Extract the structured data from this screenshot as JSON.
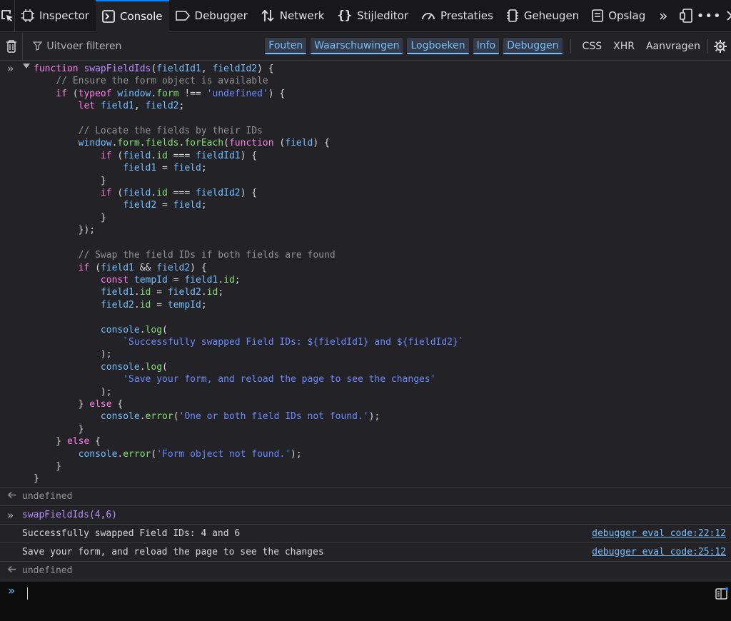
{
  "tabs": {
    "inspector": "Inspector",
    "console": "Console",
    "debugger": "Debugger",
    "network": "Netwerk",
    "style_editor": "Stijleditor",
    "performance": "Prestaties",
    "memory": "Geheugen",
    "storage": "Opslag"
  },
  "toolbar": {
    "filter_placeholder": "Uitvoer filteren",
    "levels": [
      "Fouten",
      "Waarschuwingen",
      "Logboeken",
      "Info",
      "Debuggen"
    ],
    "requests": [
      "CSS",
      "XHR",
      "Aanvragen"
    ]
  },
  "console": {
    "code_lines": [
      [
        [
          "kw",
          "function "
        ],
        [
          "fn",
          "swapFieldIds"
        ],
        [
          "",
          "("
        ],
        [
          "vr",
          "fieldId1"
        ],
        [
          "",
          ", "
        ],
        [
          "vr",
          "fieldId2"
        ],
        [
          "",
          ") {"
        ]
      ],
      [
        [
          "cm",
          "    // Ensure the form object is available"
        ]
      ],
      [
        [
          "kw",
          "    if "
        ],
        [
          "",
          "("
        ],
        [
          "kw",
          "typeof "
        ],
        [
          "vr",
          "window"
        ],
        [
          "",
          "."
        ],
        [
          "pr",
          "form"
        ],
        [
          "",
          " !== "
        ],
        [
          "st",
          "'undefined'"
        ],
        [
          "",
          ") {"
        ]
      ],
      [
        [
          "kw",
          "        let "
        ],
        [
          "vr",
          "field1"
        ],
        [
          "",
          ", "
        ],
        [
          "vr",
          "field2"
        ],
        [
          "",
          ";"
        ]
      ],
      [
        [
          "",
          ""
        ]
      ],
      [
        [
          "cm",
          "        // Locate the fields by their IDs"
        ]
      ],
      [
        [
          "vr",
          "        window"
        ],
        [
          "",
          "."
        ],
        [
          "pr",
          "form"
        ],
        [
          "",
          "."
        ],
        [
          "pr",
          "fields"
        ],
        [
          "",
          "."
        ],
        [
          "pr",
          "forEach"
        ],
        [
          "",
          "("
        ],
        [
          "kw",
          "function "
        ],
        [
          "",
          "("
        ],
        [
          "vr",
          "field"
        ],
        [
          "",
          ") {"
        ]
      ],
      [
        [
          "kw",
          "            if "
        ],
        [
          "",
          "("
        ],
        [
          "vr",
          "field"
        ],
        [
          "",
          "."
        ],
        [
          "pr",
          "id"
        ],
        [
          "",
          " === "
        ],
        [
          "vr",
          "fieldId1"
        ],
        [
          "",
          ") {"
        ]
      ],
      [
        [
          "vr",
          "                field1"
        ],
        [
          "",
          " = "
        ],
        [
          "vr",
          "field"
        ],
        [
          "",
          ";"
        ]
      ],
      [
        [
          "",
          "            }"
        ]
      ],
      [
        [
          "kw",
          "            if "
        ],
        [
          "",
          "("
        ],
        [
          "vr",
          "field"
        ],
        [
          "",
          "."
        ],
        [
          "pr",
          "id"
        ],
        [
          "",
          " === "
        ],
        [
          "vr",
          "fieldId2"
        ],
        [
          "",
          ") {"
        ]
      ],
      [
        [
          "vr",
          "                field2"
        ],
        [
          "",
          " = "
        ],
        [
          "vr",
          "field"
        ],
        [
          "",
          ";"
        ]
      ],
      [
        [
          "",
          "            }"
        ]
      ],
      [
        [
          "",
          "        });"
        ]
      ],
      [
        [
          "",
          ""
        ]
      ],
      [
        [
          "cm",
          "        // Swap the field IDs if both fields are found"
        ]
      ],
      [
        [
          "kw",
          "        if "
        ],
        [
          "",
          "("
        ],
        [
          "vr",
          "field1"
        ],
        [
          "",
          " && "
        ],
        [
          "vr",
          "field2"
        ],
        [
          "",
          ") {"
        ]
      ],
      [
        [
          "kw",
          "            const "
        ],
        [
          "vr",
          "tempId"
        ],
        [
          "",
          " = "
        ],
        [
          "vr",
          "field1"
        ],
        [
          "",
          "."
        ],
        [
          "pr",
          "id"
        ],
        [
          "",
          ";"
        ]
      ],
      [
        [
          "vr",
          "            field1"
        ],
        [
          "",
          "."
        ],
        [
          "pr",
          "id"
        ],
        [
          "",
          " = "
        ],
        [
          "vr",
          "field2"
        ],
        [
          "",
          "."
        ],
        [
          "pr",
          "id"
        ],
        [
          "",
          ";"
        ]
      ],
      [
        [
          "vr",
          "            field2"
        ],
        [
          "",
          "."
        ],
        [
          "pr",
          "id"
        ],
        [
          "",
          " = "
        ],
        [
          "vr",
          "tempId"
        ],
        [
          "",
          ";"
        ]
      ],
      [
        [
          "",
          ""
        ]
      ],
      [
        [
          "vr",
          "            console"
        ],
        [
          "",
          "."
        ],
        [
          "pr",
          "log"
        ],
        [
          "",
          "("
        ]
      ],
      [
        [
          "st",
          "                `Successfully swapped Field IDs: ${fieldId1} and ${fieldId2}`"
        ]
      ],
      [
        [
          "",
          "            );"
        ]
      ],
      [
        [
          "vr",
          "            console"
        ],
        [
          "",
          "."
        ],
        [
          "pr",
          "log"
        ],
        [
          "",
          "("
        ]
      ],
      [
        [
          "st",
          "                'Save your form, and reload the page to see the changes'"
        ]
      ],
      [
        [
          "",
          "            );"
        ]
      ],
      [
        [
          "",
          "        } "
        ],
        [
          "kw",
          "else"
        ],
        [
          "",
          " {"
        ]
      ],
      [
        [
          "vr",
          "            console"
        ],
        [
          "",
          "."
        ],
        [
          "pr",
          "error"
        ],
        [
          "",
          "("
        ],
        [
          "st",
          "'One or both field IDs not found.'"
        ],
        [
          "",
          ");"
        ]
      ],
      [
        [
          "",
          "        }"
        ]
      ],
      [
        [
          "",
          "    } "
        ],
        [
          "kw",
          "else"
        ],
        [
          "",
          " {"
        ]
      ],
      [
        [
          "vr",
          "        console"
        ],
        [
          "",
          "."
        ],
        [
          "pr",
          "error"
        ],
        [
          "",
          "("
        ],
        [
          "st",
          "'Form object not found.'"
        ],
        [
          "",
          ");"
        ]
      ],
      [
        [
          "",
          "    }"
        ]
      ],
      [
        [
          "",
          "}"
        ]
      ]
    ],
    "result_1": "undefined",
    "command_2": "swapFieldIds(4,6)",
    "log_1": "Successfully swapped Field IDs: 4 and 6",
    "log_1_location": "debugger eval code:22:12",
    "log_2": "Save your form, and reload the page to see the changes",
    "log_2_location": "debugger eval code:25:12",
    "result_2": "undefined"
  }
}
